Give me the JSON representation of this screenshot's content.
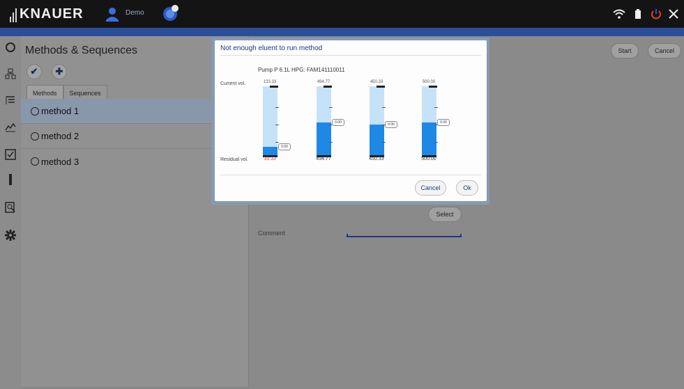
{
  "app": {
    "brand": "KNAUER",
    "user_mode": "Demo",
    "icons": [
      "wifi-icon",
      "battery-icon",
      "power-icon",
      "close-icon"
    ]
  },
  "sidebar": {
    "icons": [
      "status-icon",
      "network-icon",
      "list-icon",
      "chart-icon",
      "checklist-icon",
      "column-icon",
      "search-icon",
      "gear-icon"
    ]
  },
  "left_panel": {
    "title": "Methods & Sequences",
    "tabs": [
      "Methods",
      "Sequences"
    ],
    "items": [
      "method 1",
      "method 2",
      "method 3"
    ],
    "selected_index": 0
  },
  "right_panel": {
    "start_label": "Start",
    "cancel_label": "Cancel",
    "select_label": "Select",
    "comment_label": "Comment"
  },
  "dialog": {
    "title": "Not enough eluent to run method",
    "pump": "Pump P 6.1L HPG: FAM141110011",
    "current_label": "Current vol.",
    "residual_label": "Residual vol.",
    "bottles": [
      {
        "current": "133.33",
        "residual": "33.33",
        "mark": "0.00",
        "fill": 0.13,
        "warn": true
      },
      {
        "current": "494.77",
        "residual": "494.77",
        "mark": "0.00",
        "fill": 0.48,
        "warn": false
      },
      {
        "current": "450.33",
        "residual": "450.33",
        "mark": "0.00",
        "fill": 0.45,
        "warn": false
      },
      {
        "current": "500.00",
        "residual": "500.00",
        "mark": "0.00",
        "fill": 0.48,
        "warn": false
      }
    ],
    "cancel_label": "Cancel",
    "ok_label": "Ok"
  },
  "colors": {
    "accent": "#1b3a7a",
    "fill": "#1e88e5",
    "bottle": "#c6e2f8",
    "warn": "#e53935"
  }
}
